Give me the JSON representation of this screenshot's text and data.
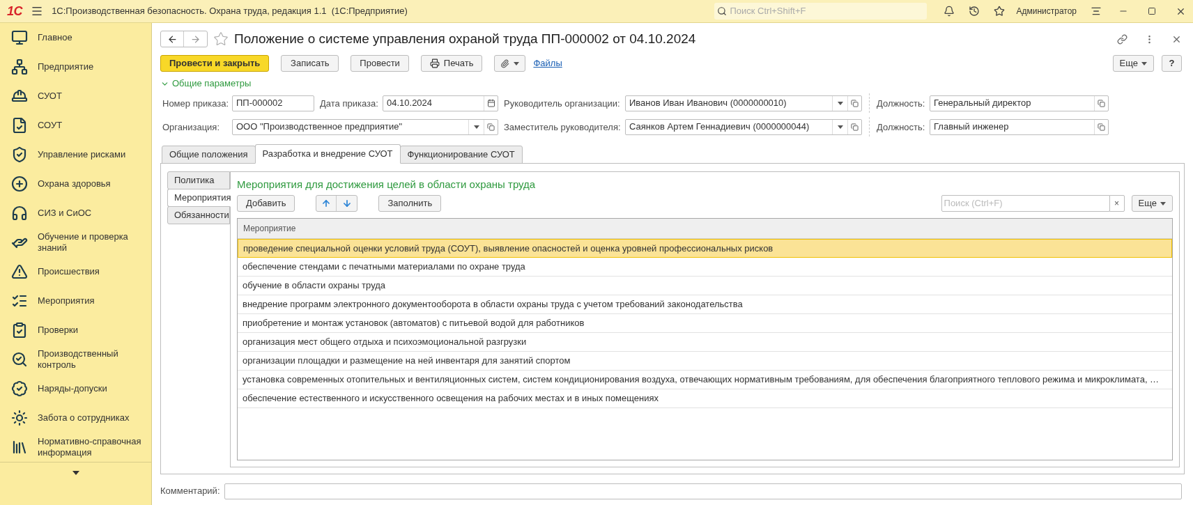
{
  "app": {
    "logo": "1С",
    "title": "1С:Производственная безопасность. Охрана труда, редакция 1.1  (1С:Предприятие)",
    "search_placeholder": "Поиск Ctrl+Shift+F",
    "user": "Администратор"
  },
  "sidebar": {
    "items": [
      {
        "label": "Главное"
      },
      {
        "label": "Предприятие"
      },
      {
        "label": "СУОТ"
      },
      {
        "label": "СОУТ"
      },
      {
        "label": "Управление рисками"
      },
      {
        "label": "Охрана здоровья"
      },
      {
        "label": "СИЗ и СиОС"
      },
      {
        "label": "Обучение и проверка знаний"
      },
      {
        "label": "Происшествия"
      },
      {
        "label": "Мероприятия"
      },
      {
        "label": "Проверки"
      },
      {
        "label": "Производственный контроль"
      },
      {
        "label": "Наряды-допуски"
      },
      {
        "label": "Забота о сотрудниках"
      },
      {
        "label": "Нормативно-справочная информация"
      }
    ]
  },
  "document": {
    "title": "Положение о системе управления охраной труда ПП-000002 от 04.10.2024",
    "toolbar": [
      {
        "label": "Провести и закрыть",
        "kind": "primary"
      },
      {
        "label": "Записать",
        "kind": "plain"
      },
      {
        "label": "Провести",
        "kind": "plain"
      },
      {
        "label": "Печать",
        "kind": "print"
      },
      {
        "kind": "attach"
      },
      {
        "label": "Файлы",
        "kind": "link"
      }
    ],
    "more": "Еще",
    "help": "?",
    "params": {
      "title": "Общие параметры",
      "expanded": true,
      "fields": [
        {
          "label": "Номер приказа:",
          "value": "ПП-000002",
          "kind": "text"
        },
        {
          "label": "Дата приказа:",
          "value": "04.10.2024",
          "kind": "date"
        },
        {
          "label": "Руководитель организации:",
          "value": "Иванов Иван Иванович (0000000010)",
          "kind": "select"
        },
        {
          "label": "Должность:",
          "value": "Генеральный директор",
          "kind": "ref"
        },
        {
          "label": "Организация:",
          "value": "ООО \"Производственное предприятие\"",
          "kind": "select"
        },
        {
          "label": "Заместитель руководителя:",
          "value": "Саянков Артем Геннадиевич (0000000044)",
          "kind": "select"
        },
        {
          "label": "Должность:",
          "value": "Главный инженер",
          "kind": "ref"
        }
      ]
    },
    "tabs": [
      {
        "label": "Общие положения",
        "selected": false
      },
      {
        "label": "Разработка и внедрение СУОТ",
        "selected": true
      },
      {
        "label": "Функционирование СУОТ",
        "selected": false
      }
    ],
    "subtabs": [
      {
        "label": "Политика",
        "selected": false
      },
      {
        "label": "Мероприятия",
        "selected": true
      },
      {
        "label": "Обязанности",
        "selected": false
      }
    ],
    "section": {
      "title": "Мероприятия для достижения целей в области охраны труда",
      "add": "Добавить",
      "fill": "Заполнить",
      "search_placeholder": "Поиск (Ctrl+F)",
      "clear": "×",
      "more": "Еще",
      "table": {
        "columns": [
          "Мероприятие"
        ],
        "rows": [
          {
            "text": "проведение специальной оценки условий труда (СОУТ), выявление опасностей и оценка уровней профессиональных рисков",
            "selected": true
          },
          {
            "text": "обеспечение стендами с печатными материалами по охране труда",
            "selected": false
          },
          {
            "text": "обучение в области охраны труда",
            "selected": false
          },
          {
            "text": "внедрение программ электронного документооборота в области охраны труда с учетом требований законодательства",
            "selected": false
          },
          {
            "text": "приобретение и монтаж установок (автоматов) с питьевой водой для работников",
            "selected": false
          },
          {
            "text": "организация мест общего отдыха и психоэмоциональной разгрузки",
            "selected": false
          },
          {
            "text": "организации площадки и размещение на ней инвентаря для занятий спортом",
            "selected": false
          },
          {
            "text": "установка современных отопительных и вентиляционных систем, систем кондиционирования воздуха, отвечающих нормативным требованиям, для обеспечения благоприятного теплового режима и микроклимата, …",
            "selected": false
          },
          {
            "text": "обеспечение естественного и искусственного освещения на рабочих местах и в иных помещениях",
            "selected": false
          }
        ]
      }
    },
    "comment": {
      "label": "Комментарий:"
    }
  }
}
